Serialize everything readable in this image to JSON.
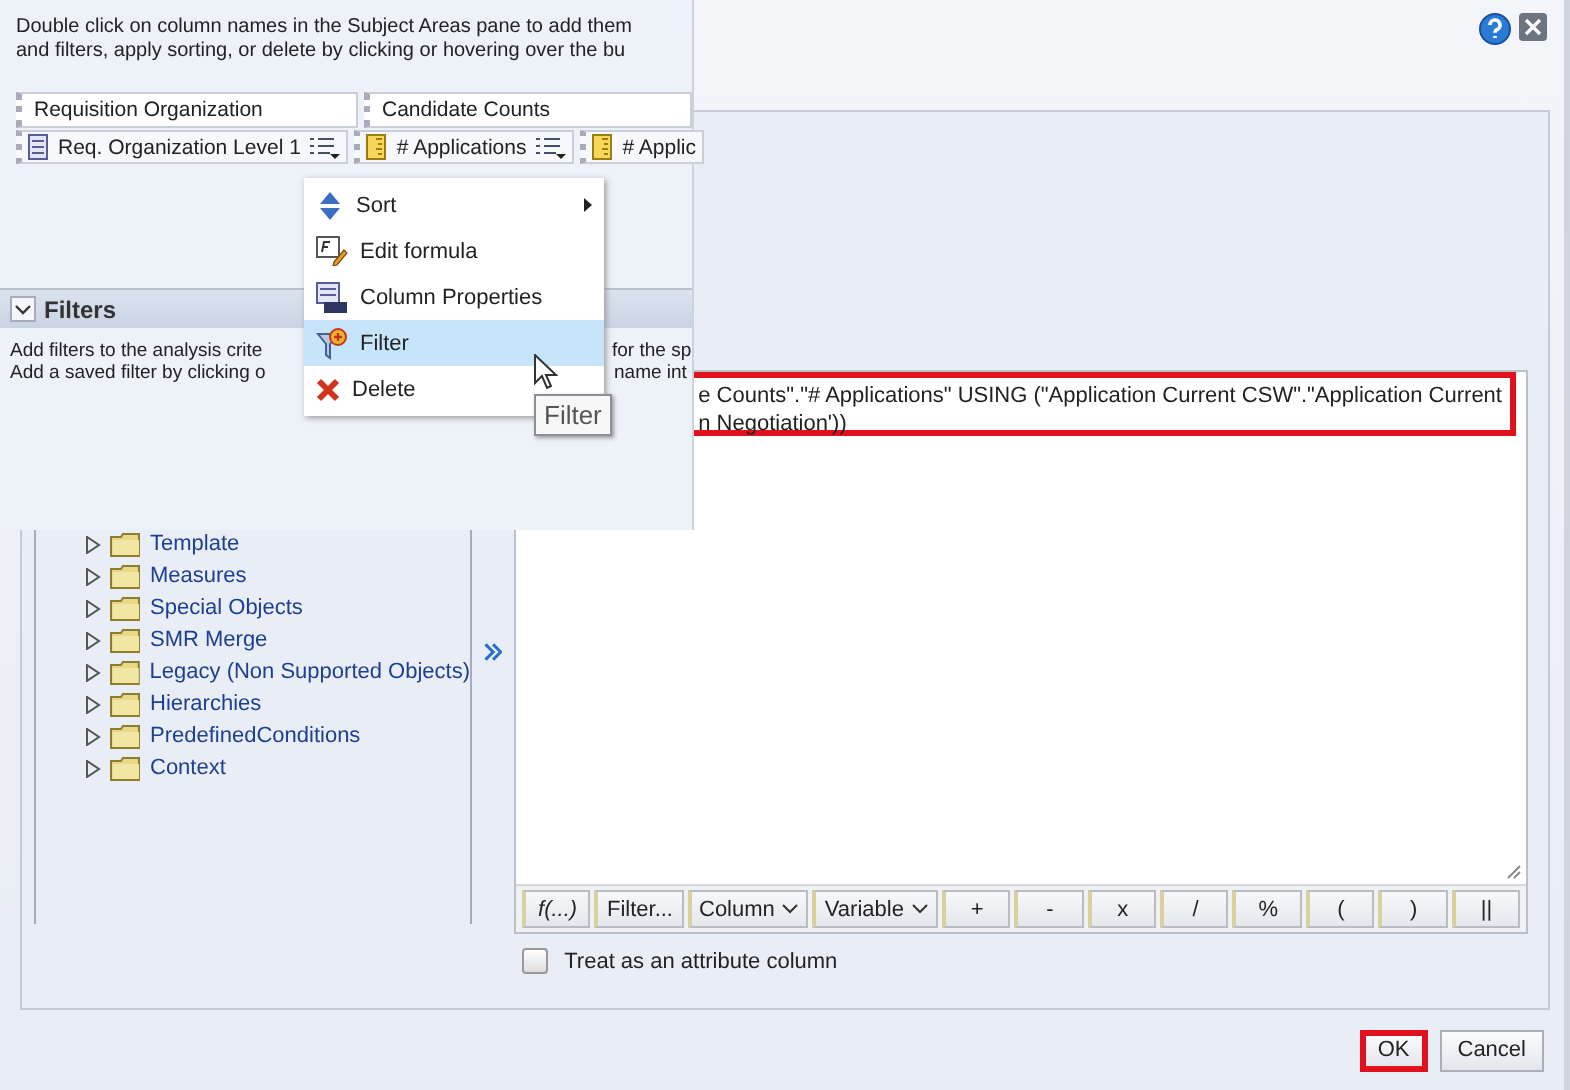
{
  "overlay": {
    "instructions": [
      "Double click on column names in the Subject Areas pane to add them",
      "and filters, apply sorting, or delete by clicking or hovering over the bu"
    ],
    "column_groups": [
      {
        "label": "Requisition Organization"
      },
      {
        "label": "Candidate Counts"
      }
    ],
    "columns": [
      {
        "label": "Req. Organization Level 1",
        "kind": "attribute",
        "menu": true
      },
      {
        "label": "# Applications",
        "kind": "measure",
        "menu": true
      },
      {
        "label": "# Applic",
        "kind": "measure",
        "menu": false
      }
    ],
    "filters": {
      "title": "Filters",
      "expanded": true,
      "description": [
        {
          "left": "Add filters to the analysis crite",
          "right": "for the sp"
        },
        {
          "left": "Add a saved filter by clicking o",
          "right": "name int"
        }
      ]
    },
    "context_menu": [
      {
        "label": "Sort",
        "kind": "sort",
        "submenu": true,
        "selected": false
      },
      {
        "label": "Edit formula",
        "kind": "formula",
        "submenu": false,
        "selected": false
      },
      {
        "label": "Column Properties",
        "kind": "properties",
        "submenu": false,
        "selected": false
      },
      {
        "label": "Filter",
        "kind": "filter",
        "submenu": false,
        "selected": true
      },
      {
        "label": "Delete",
        "kind": "delete",
        "submenu": false,
        "selected": false
      }
    ],
    "tooltip": "Filter"
  },
  "tree": [
    {
      "label": "Template",
      "expanded": false
    },
    {
      "label": "Measures",
      "expanded": false
    },
    {
      "label": "Special Objects",
      "expanded": false
    },
    {
      "label": "SMR Merge",
      "expanded": false
    },
    {
      "label": "Legacy (Non Supported Objects)",
      "expanded": false
    },
    {
      "label": "Hierarchies",
      "expanded": false
    },
    {
      "label": "PredefinedConditions",
      "expanded": false
    },
    {
      "label": "Context",
      "expanded": false
    }
  ],
  "formula": {
    "lines": [
      "e Counts\".\"# Applications\" USING (\"Application Current CSW\".\"Application Current",
      "n Negotiation'))"
    ],
    "highlighted": true
  },
  "toolbar": [
    {
      "label": "f(...)",
      "kind": "function"
    },
    {
      "label": "Filter...",
      "kind": "plain"
    },
    {
      "label": "Column",
      "kind": "dropdown"
    },
    {
      "label": "Variable",
      "kind": "dropdown"
    },
    {
      "label": "+",
      "kind": "plain"
    },
    {
      "label": "-",
      "kind": "plain"
    },
    {
      "label": "x",
      "kind": "plain"
    },
    {
      "label": "/",
      "kind": "plain"
    },
    {
      "label": "%",
      "kind": "plain"
    },
    {
      "label": "(",
      "kind": "plain"
    },
    {
      "label": ")",
      "kind": "plain"
    },
    {
      "label": "||",
      "kind": "plain"
    }
  ],
  "attribute_checkbox": {
    "label": "Treat as an attribute column",
    "checked": false
  },
  "buttons": [
    {
      "label": "OK",
      "highlighted": true
    },
    {
      "label": "Cancel",
      "highlighted": false
    }
  ]
}
